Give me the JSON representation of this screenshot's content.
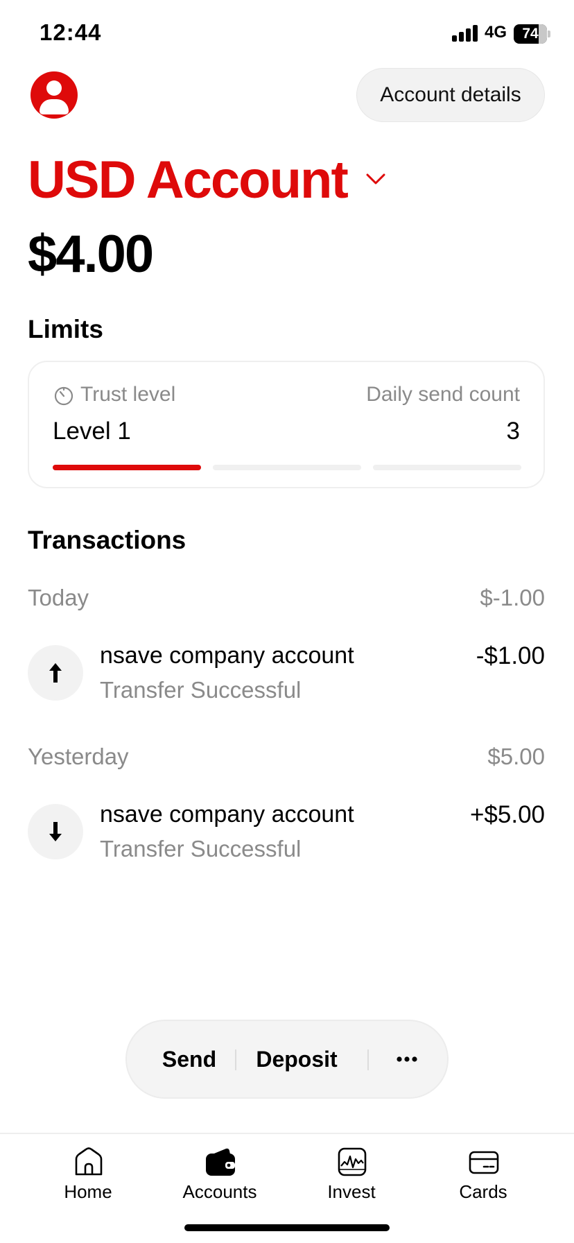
{
  "status_bar": {
    "time": "12:44",
    "network": "4G",
    "battery": "74",
    "battery_level_percent": 74
  },
  "header": {
    "account_details_label": "Account details"
  },
  "account": {
    "title": "USD Account",
    "balance": "$4.00"
  },
  "limits": {
    "title": "Limits",
    "trust_label": "Trust level",
    "trust_value": "Level 1",
    "daily_send_label": "Daily send count",
    "daily_send_value": "3",
    "level_progress": {
      "current": 1,
      "total": 3
    }
  },
  "transactions": {
    "title": "Transactions",
    "groups": [
      {
        "label": "Today",
        "total": "$-1.00",
        "items": [
          {
            "name": "nsave company account",
            "status": "Transfer Successful",
            "amount": "-$1.00",
            "direction": "out"
          }
        ]
      },
      {
        "label": "Yesterday",
        "total": "$5.00",
        "items": [
          {
            "name": "nsave company account",
            "status": "Transfer Successful",
            "amount": "+$5.00",
            "direction": "in"
          }
        ]
      }
    ]
  },
  "actions": {
    "send_label": "Send",
    "deposit_label": "Deposit",
    "more_icon": "more-icon"
  },
  "tab_bar": {
    "items": [
      {
        "label": "Home",
        "icon": "home-icon"
      },
      {
        "label": "Accounts",
        "icon": "wallet-icon",
        "active": true
      },
      {
        "label": "Invest",
        "icon": "chart-icon"
      },
      {
        "label": "Cards",
        "icon": "card-icon"
      }
    ]
  },
  "colors": {
    "brand_red": "#de0a0a",
    "muted_text": "#8a8a8a",
    "pill_background": "#f4f4f4"
  }
}
